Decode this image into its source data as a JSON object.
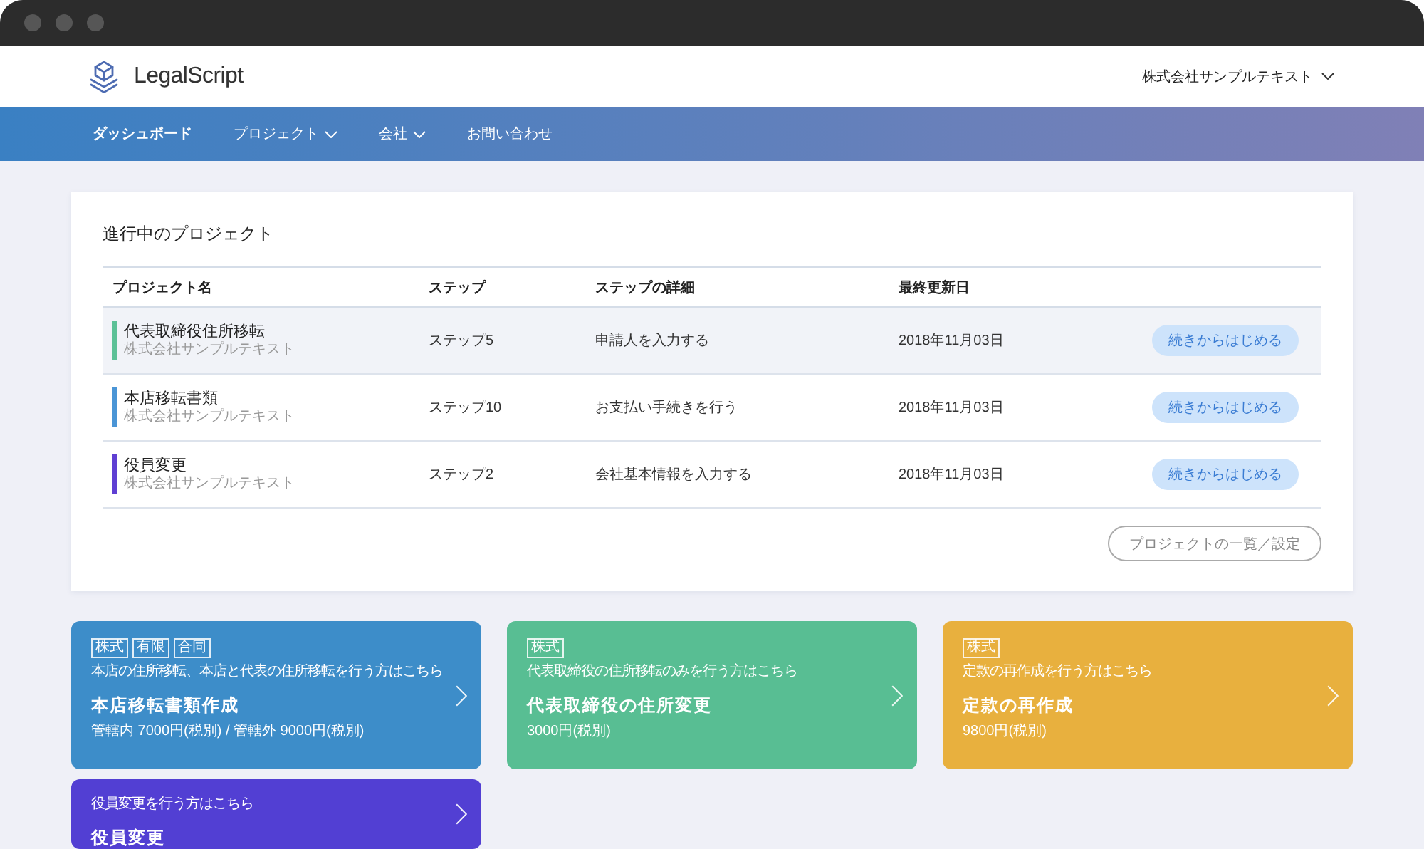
{
  "header": {
    "logo": "LegalScript",
    "account": "株式会社サンプルテキスト"
  },
  "nav": [
    {
      "label": "ダッシュボード",
      "selected": true,
      "dropdown": false
    },
    {
      "label": "プロジェクト",
      "selected": false,
      "dropdown": true
    },
    {
      "label": "会社",
      "selected": false,
      "dropdown": true
    },
    {
      "label": "お問い合わせ",
      "selected": false,
      "dropdown": false
    }
  ],
  "projects": {
    "title": "進行中のプロジェクト",
    "columns": [
      "プロジェクト名",
      "ステップ",
      "ステップの詳細",
      "最終更新日"
    ],
    "rows": [
      {
        "name": "代表取締役住所移転",
        "company": "株式会社サンプルテキスト",
        "step": "ステップ5",
        "detail": "申請人を入力する",
        "updated": "2018年11月03日",
        "action": "続きからはじめる",
        "color": "#5cc197",
        "selected": true
      },
      {
        "name": "本店移転書類",
        "company": "株式会社サンプルテキスト",
        "step": "ステップ10",
        "detail": "お支払い手続きを行う",
        "updated": "2018年11月03日",
        "action": "続きからはじめる",
        "color": "#4a95d6",
        "selected": false
      },
      {
        "name": "役員変更",
        "company": "株式会社サンプルテキスト",
        "step": "ステップ2",
        "detail": "会社基本情報を入力する",
        "updated": "2018年11月03日",
        "action": "続きからはじめる",
        "color": "#5f3fd3",
        "selected": false
      }
    ],
    "list_button": "プロジェクトの一覧／設定"
  },
  "services": [
    {
      "tags": [
        "株式",
        "有限",
        "合同"
      ],
      "description": "本店の住所移転、本店と代表の住所移転を行う方はこちら",
      "title": "本店移転書類作成",
      "price": "管轄内 7000円(税別) / 管轄外 9000円(税別)",
      "color": "#3d8dc9"
    },
    {
      "tags": [
        "株式"
      ],
      "description": "代表取締役の住所移転のみを行う方はこちら",
      "title": "代表取締役の住所変更",
      "price": "3000円(税別)",
      "color": "#58be93"
    },
    {
      "tags": [
        "株式"
      ],
      "description": "定款の再作成を行う方はこちら",
      "title": "定款の再作成",
      "price": "9800円(税別)",
      "color": "#e8b03e"
    },
    {
      "description": "役員変更を行う方はこちら",
      "title": "役員変更",
      "color": "#523fd3"
    }
  ]
}
